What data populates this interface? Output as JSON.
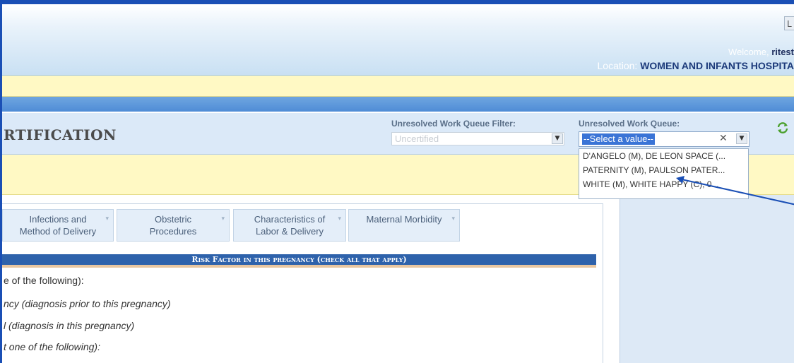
{
  "header": {
    "logout_label": "L",
    "welcome_prefix": "Welcome, ",
    "welcome_user": "ritest",
    "location_label": "Location: ",
    "location_value": "WOMEN AND INFANTS HOSPITA"
  },
  "page": {
    "title": "RTIFICATION"
  },
  "filters": {
    "filter_label": "Unresolved Work Queue Filter:",
    "filter_value": "Uncertified",
    "queue_label": "Unresolved Work Queue:",
    "queue_value": "--Select a value--",
    "queue_options": [
      "D'ANGELO (M), DE LEON SPACE (...",
      "PATERNITY (M), PAULSON PATER...",
      "WHITE (M), WHITE HAPPY (C), 0..."
    ]
  },
  "tabs": [
    {
      "line1": "Infections and",
      "line2": "Method of Delivery"
    },
    {
      "line1": "Obstetric",
      "line2": "Procedures"
    },
    {
      "line1": "Characteristics of",
      "line2": "Labor & Delivery"
    },
    {
      "line1": "Maternal Morbidity",
      "line2": ""
    }
  ],
  "section": {
    "header": "Risk Factor in this pregnancy (check all that apply)",
    "lines": [
      {
        "text": "e of the following):",
        "italic": false
      },
      {
        "text": "ncy (diagnosis prior to this pregnancy)",
        "italic": true
      },
      {
        "text": "l (diagnosis in this pregnancy)",
        "italic": true
      },
      {
        "text": "t one of the following):",
        "italic": true
      }
    ]
  },
  "colors": {
    "frame": "#1a4fb5",
    "accent_blue": "#2e62ab",
    "highlight": "#fff9c4",
    "arrow": "#1a4fb5"
  }
}
